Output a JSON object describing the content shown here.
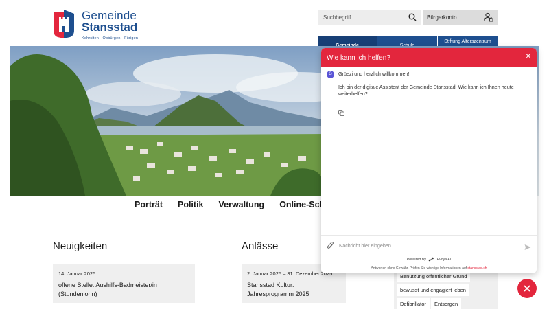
{
  "header": {
    "logo": {
      "line1": "Gemeinde",
      "line2": "Stansstad",
      "line3": "Kehrsiten · Obbürgen · Fürigen"
    },
    "search_placeholder": "Suchbegriff",
    "account_label": "Bürgerkonto",
    "topnav": [
      "Gemeinde",
      "Schule",
      "Stiftung Alterszentrum"
    ]
  },
  "mainnav": [
    "Porträt",
    "Politik",
    "Verwaltung",
    "Online-Schalter"
  ],
  "news": {
    "title": "Neuigkeiten",
    "card": {
      "date": "14. Januar 2025",
      "title": "offene Stelle: Aushilfs-Badmeister/in (Stundenlohn)"
    }
  },
  "events": {
    "title": "Anlässe",
    "card": {
      "date": "2. Januar 2025 – 31. Dezember 2025",
      "title": "Stansstad Kultur: Jahresprogramm 2025"
    }
  },
  "tags": [
    "Benutzung öffentlicher Grund",
    "bewusst und engagiert leben",
    "Defibrillator",
    "Entsorgen"
  ],
  "chat": {
    "header": "Wie kann ich helfen?",
    "avatar_letter": "G",
    "greeting": "Grüezi und herzlich willkommen!",
    "intro": "Ich bin der digitale Assistent der Gemeinde Stansstad. Wie kann ich Ihnen heute weiterhelfen?",
    "input_placeholder": "Nachricht hier eingeben...",
    "powered_by": "Powered By",
    "powered_brand": "Evoya AI",
    "disclaimer": "Antworten ohne Gewähr. Prüfen Sie wichtige Informationen auf",
    "disclaimer_link": "stansstad.ch"
  },
  "colors": {
    "brand_blue": "#1e4f8f",
    "accent_red": "#e3263d"
  }
}
